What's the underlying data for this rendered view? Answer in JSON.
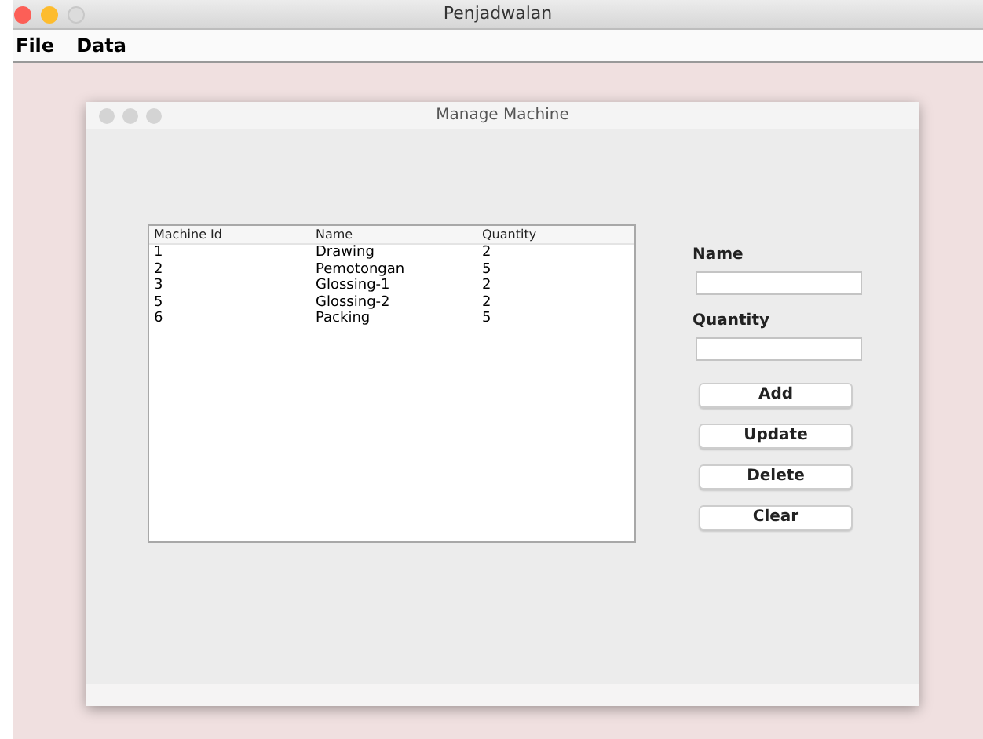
{
  "window": {
    "title": "Penjadwalan"
  },
  "menu": [
    "File",
    "Data"
  ],
  "dialog": {
    "title": "Manage Machine",
    "table": {
      "columns": [
        "Machine Id",
        "Name",
        "Quantity"
      ],
      "rows": [
        [
          "1",
          "Drawing",
          "2"
        ],
        [
          "2",
          "Pemotongan",
          "5"
        ],
        [
          "3",
          "Glossing-1",
          "2"
        ],
        [
          "5",
          "Glossing-2",
          "2"
        ],
        [
          "6",
          "Packing",
          "5"
        ]
      ]
    },
    "fields": [
      {
        "label": "Name"
      },
      {
        "label": "Quantity"
      }
    ],
    "buttons": [
      "Add",
      "Update",
      "Delete",
      "Clear"
    ]
  }
}
